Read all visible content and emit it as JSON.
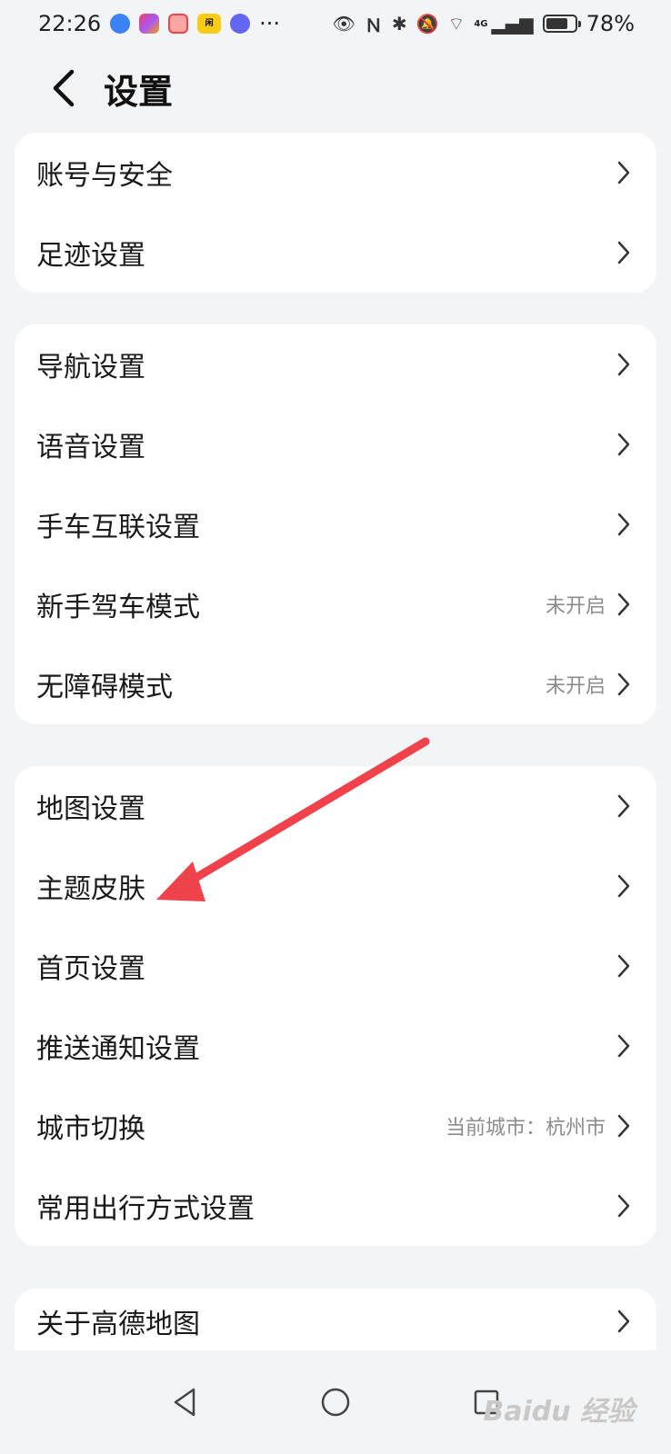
{
  "status_bar": {
    "time": "22:26",
    "network": "4G",
    "battery": "78%",
    "more": "···"
  },
  "header": {
    "title": "设置"
  },
  "sections": [
    {
      "items": [
        {
          "label": "账号与安全",
          "value": ""
        },
        {
          "label": "足迹设置",
          "value": ""
        }
      ]
    },
    {
      "items": [
        {
          "label": "导航设置",
          "value": ""
        },
        {
          "label": "语音设置",
          "value": ""
        },
        {
          "label": "手车互联设置",
          "value": ""
        },
        {
          "label": "新手驾车模式",
          "value": "未开启"
        },
        {
          "label": "无障碍模式",
          "value": "未开启"
        }
      ]
    },
    {
      "items": [
        {
          "label": "地图设置",
          "value": ""
        },
        {
          "label": "主题皮肤",
          "value": ""
        },
        {
          "label": "首页设置",
          "value": ""
        },
        {
          "label": "推送通知设置",
          "value": ""
        },
        {
          "label": "城市切换",
          "value": "当前城市：杭州市"
        },
        {
          "label": "常用出行方式设置",
          "value": ""
        }
      ]
    },
    {
      "items": [
        {
          "label": "关于高德地图",
          "value": ""
        }
      ]
    }
  ],
  "watermark": "Baidu 经验",
  "colors": {
    "background": "#f3f4f6",
    "card": "#ffffff",
    "annotation_arrow": "#f0424b",
    "secondary_text": "#8c8c8c"
  }
}
